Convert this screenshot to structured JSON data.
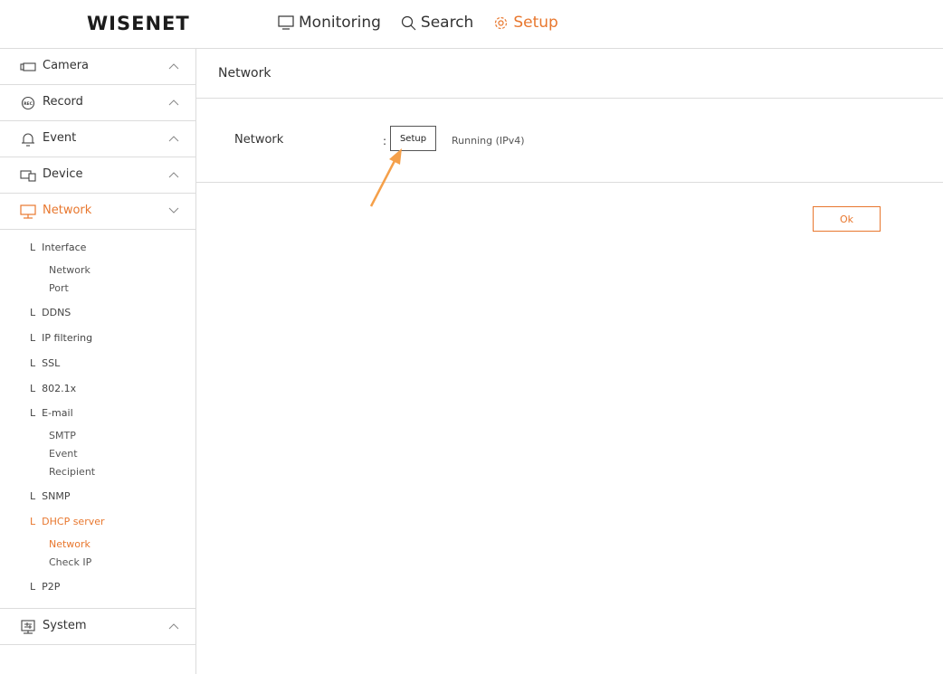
{
  "brand": {
    "logo": "WISENET"
  },
  "topnav": {
    "items": [
      {
        "label": "Monitoring",
        "icon": "monitor-icon"
      },
      {
        "label": "Search",
        "icon": "search-icon"
      },
      {
        "label": "Setup",
        "icon": "gear-icon"
      }
    ],
    "active": "Setup"
  },
  "sidebar": {
    "sections": [
      {
        "label": "Camera",
        "icon": "camera-icon",
        "expanded": false
      },
      {
        "label": "Record",
        "icon": "rec-icon",
        "expanded": false
      },
      {
        "label": "Event",
        "icon": "bell-icon",
        "expanded": false
      },
      {
        "label": "Device",
        "icon": "device-icon",
        "expanded": false
      },
      {
        "label": "Network",
        "icon": "network-icon",
        "expanded": true
      },
      {
        "label": "System",
        "icon": "system-icon",
        "expanded": false
      }
    ],
    "network_items": {
      "interface": "Interface",
      "interface_network": "Network",
      "interface_port": "Port",
      "ddns": "DDNS",
      "ip_filtering": "IP filtering",
      "ssl": "SSL",
      "dot1x": "802.1x",
      "email": "E-mail",
      "email_smtp": "SMTP",
      "email_event": "Event",
      "email_recipient": "Recipient",
      "snmp": "SNMP",
      "dhcp_server": "DHCP server",
      "dhcp_network": "Network",
      "dhcp_check_ip": "Check IP",
      "p2p": "P2P"
    },
    "branch_glyph": "L"
  },
  "main": {
    "title": "Network",
    "row_label": "Network",
    "colon": ":",
    "setup_button": "Setup",
    "status": "Running (IPv4)",
    "ok_button": "Ok"
  },
  "colors": {
    "accent": "#e8772e",
    "arrow": "#f5a04a",
    "border": "#dcdcdc"
  }
}
